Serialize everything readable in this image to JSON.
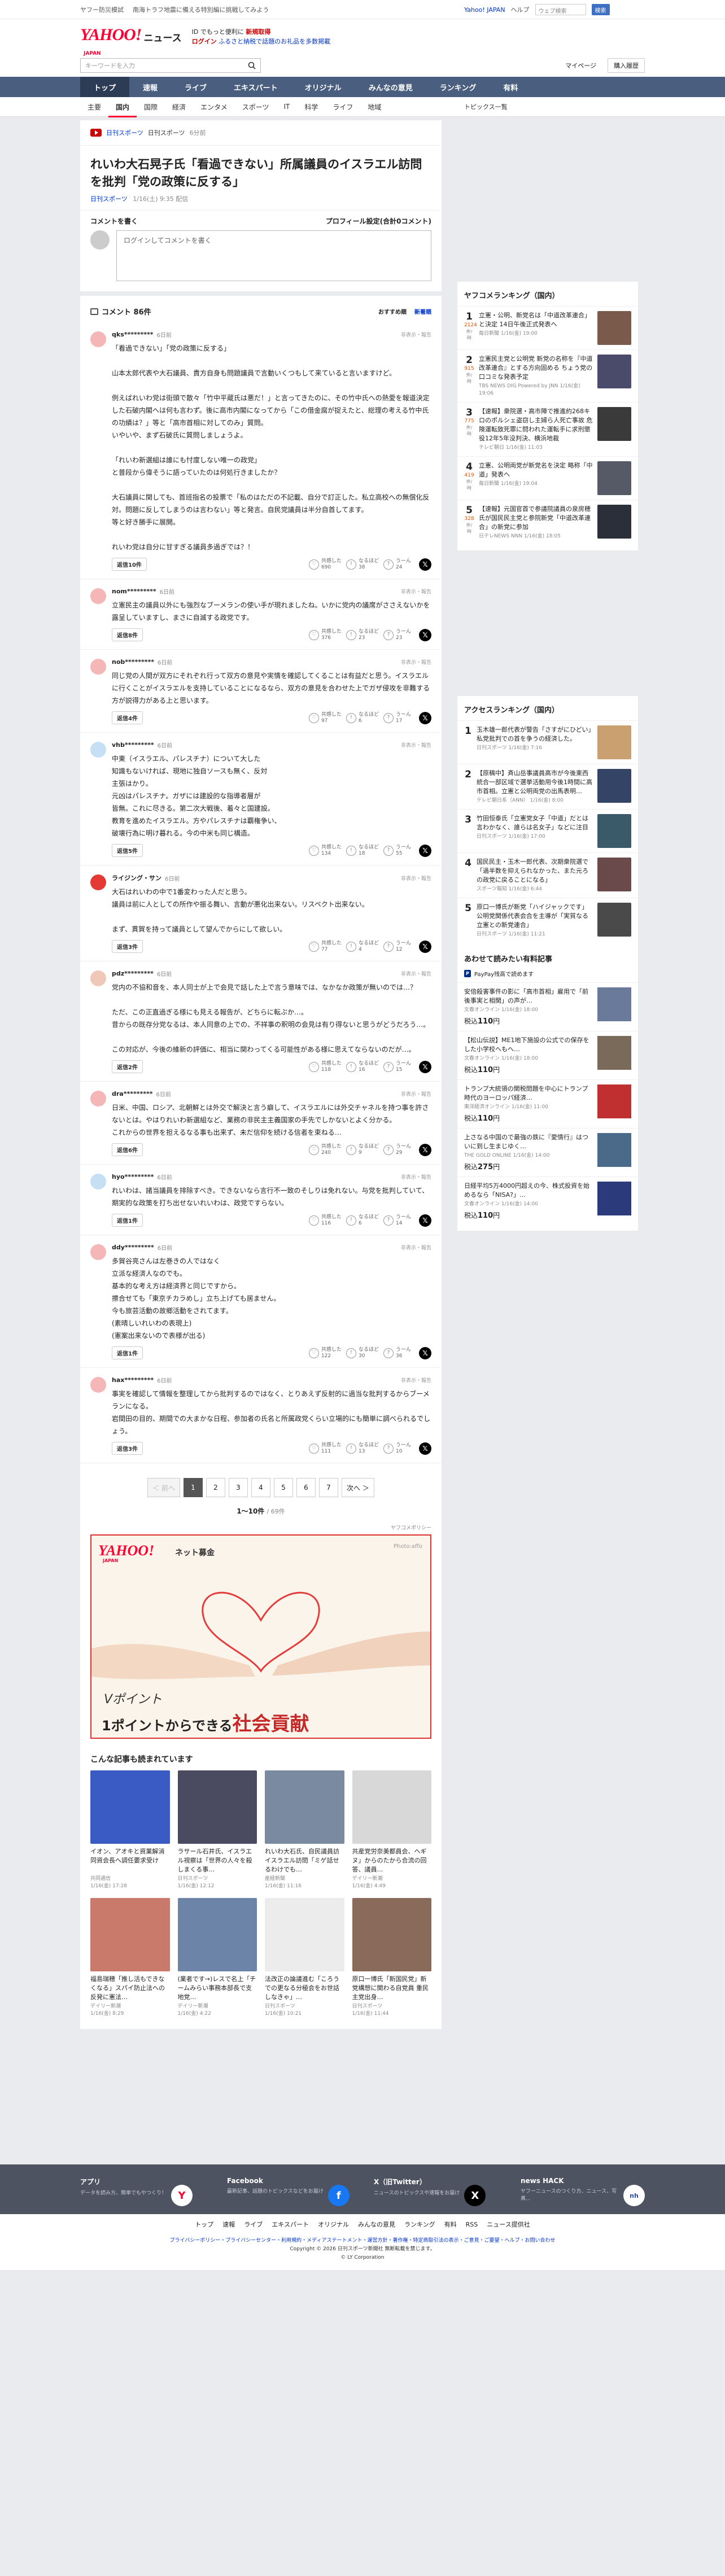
{
  "topbar": {
    "links": [
      "ヤフー防災模試",
      "南海トラフ地震に備える特別編に挑戦してみよう"
    ],
    "jp": "Yahoo! JAPAN",
    "help": "ヘルプ",
    "search_placeholder": "ウェブ検索",
    "search_btn": "検索"
  },
  "header": {
    "logo": "YAHOO!",
    "logo_sub": "JAPAN",
    "news": "ニュース",
    "promo_l1a": "ID でもっと便利に",
    "promo_l1b": "新規取得",
    "promo_l2a": "ログイン",
    "promo_l2b": "ふるさと納税で話題のお礼品を多数掲載"
  },
  "searchbar": {
    "placeholder": "キーワードを入力",
    "mypage": "マイページ",
    "purchase": "購入履歴"
  },
  "gnav": [
    "トップ",
    "速報",
    "ライブ",
    "エキスパート",
    "オリジナル",
    "みんなの意見",
    "ランキング",
    "有料"
  ],
  "subnav": [
    "主要",
    "国内",
    "国際",
    "経済",
    "エンタメ",
    "スポーツ",
    "IT",
    "科学",
    "ライフ",
    "地域"
  ],
  "subnav_right": "トピックス一覧",
  "article": {
    "source": "日刊スポーツ",
    "source_note": "日刊スポーツ",
    "source_time": "6分前",
    "title": "れいわ大石晃子氏「看過できない」所属議員のイスラエル訪問を批判「党の政策に反する」",
    "meta_src": "日刊スポーツ",
    "meta_time": "1/16(土) 9:35 配信"
  },
  "comment_form": {
    "heading": "コメントを書く",
    "profile_link": "プロフィール設定(合計0コメント)",
    "placeholder": "ログインしてコメントを書く"
  },
  "comments_head": {
    "title": "コメント 86件",
    "sort1": "おすすめ順",
    "sort2": "新着順"
  },
  "comment_labels": {
    "report": "非表示・報告",
    "reply": "返信",
    "like": "共感した",
    "think": "なるほど",
    "meh": "うーん"
  },
  "comments": [
    {
      "user": "qks*********",
      "time": "6日前",
      "text": "「看過できない」「党の政策に反する」\n\n山本太郎代表や大石議員、貴方自身も問題議員で言動いくつもして来ていると言いますけど。\n\n例えばれいわ党は街頭で散々「竹中平蔵氏は悪だ！」と言ってきたのに、その竹中氏への熱愛を報道決定した石破内閣へは何も言わず。後に高市内閣になってから「この借金腐が捉えたと、総理の考える竹中氏の功績は？」等と「高市首相に対してのみ」質問。\nいやいや、まず石破氏に質問しましょうよ。\n\n「れいわ新選組は誰にも忖度しない唯一の政党」\nと普段から偉そうに語っていたのは何処行きましたか？\n\n大石議員に関しても、首班指名の投票で「私のはただの不記載、自分で訂正した。私立高校への無償化反対。問題に反してしまうのは言わない」等と発言。自民党議員は半分自首してます。\n等と好き勝手に展開。\n\nれいわ党は自分に甘すぎる議員多過ぎでは？！",
      "like": "690",
      "think": "38",
      "meh": "24",
      "replies": "返信10件"
    },
    {
      "user": "nom*********",
      "time": "6日前",
      "text": "立憲民主の議員以外にも強烈なブーメランの使い手が現れましたね。いかに党内の議席がささえないかを露呈していますし、まさに自滅する政党です。",
      "like": "376",
      "think": "23",
      "meh": "23",
      "replies": "返信8件"
    },
    {
      "user": "nob*********",
      "time": "6日前",
      "text": "同じ党の人間が双方にそれぞれ行って双方の意見や実情を確認してくることは有益だと思う。イスラエルに行くことがイスラエルを支持していることになるなら、双方の意見を合わせた上でガザ侵攻を非難する方が説得力がある上と思います。",
      "like": "97",
      "think": "6",
      "meh": "17",
      "replies": "返信4件"
    },
    {
      "user": "vhb*********",
      "time": "6日前",
      "text": "中東（イスラエル、パレスチナ）について大した\n知識もないければ、現地に独自ソースも無く、反対\n主張はかり。\n元凶はパレスチナ。ガザには建設的な指導者層が\n皆無。これに尽きる。第二次大戦後、着々と国建設。\n教育を進めたイスラエル。方やパレスチナは覇権争い、\n破壊行為に明け暮れる。今の中米も同じ構造。",
      "like": "134",
      "think": "18",
      "meh": "55",
      "replies": "返信5件"
    },
    {
      "user": "ライジング・サン",
      "time": "6日前",
      "text": "大石はれいわの中で1番変わった人だと思う。\n議員は前に人としての所作や振る舞い、言動が悪化出来ない。リスペクト出来ない。\n\nまず、貫賀を持って議員として望んでからにして欲しい。",
      "like": "77",
      "think": "4",
      "meh": "12",
      "replies": "返信3件"
    },
    {
      "user": "pdz*********",
      "time": "6日前",
      "text": "党内の不協和音を、本人同士が上で会見で話した上で言う意味では、なかなか政策が無いのでは…？\n\nただ、この正直過ぎる様にも見える報告が、どちらに転ぶか…。\n昔からの既存分党なるは、本人同意の上での、不祥事の釈明の会見は有り得ないと思うがどうだろう…。\n\nこの対応が、今後の維新の評価に、相当に関わってくる可能性がある様に思えてならないのだが…。",
      "like": "118",
      "think": "16",
      "meh": "15",
      "replies": "返信2件"
    },
    {
      "user": "dra*********",
      "time": "6日前",
      "text": "日米、中国、ロシア、北朝鮮とは外交で解決と言う癖して、イスラエルには外交チャネルを持つ事を許さないとは。やはりれいわ新選組など、業務の非民主主義国家の手先でしかないとよく分かる。\nこれからの世界を担えるなる事も出来ず、未だ信仰を続ける信者を束ねる…",
      "like": "240",
      "think": "9",
      "meh": "29",
      "replies": "返信6件"
    },
    {
      "user": "hyo*********",
      "time": "6日前",
      "text": "れいわは、諸当議員を排除すべき。できないなら言行不一致のそしりは免れない。与党を批判していて、期実的な政策を打ち出せないれいわは、政党ですらない。",
      "like": "116",
      "think": "6",
      "meh": "14",
      "replies": "返信1件"
    },
    {
      "user": "ddy*********",
      "time": "6日前",
      "text": "多賀谷亮さんは左巻きの人ではなく\n立派な経済人なのでも。\n基本的な考え方は経済界と同じですから。\n擦合せても「東京チカラめし」立ち上げても居ません。\n今も旅芸活動の故郷活動をされてます。\n(素晴しいれいわの表現上)\n(憲案出来ないので表様が出る)",
      "like": "122",
      "think": "30",
      "meh": "36",
      "replies": "返信1件"
    },
    {
      "user": "hax*********",
      "time": "6日前",
      "text": "事実を確認して情報を整理してから批判するのではなく、とりあえず反射的に過当な批判するからブーメランになる。\n岩間田の目的、期間での大まかな日程、参加者の氏名と所属政党くらい立場的にも簡単に調べられるでしょう。",
      "like": "111",
      "think": "13",
      "meh": "10",
      "replies": "返信3件"
    }
  ],
  "pager": {
    "prev": "＜ 前へ",
    "pages": [
      "1",
      "2",
      "3",
      "4",
      "5",
      "6",
      "7"
    ],
    "next": "次へ ＞",
    "count": "1〜10件",
    "total": "/ 69件"
  },
  "ad": {
    "label": "ヤフコメポリシー",
    "logo": "YAHOO!",
    "logo_sub": "JAPAN",
    "kifu": "ネット募金",
    "photo": "Photo:affo",
    "l1": "Vポイント",
    "l1b": "1ポイントからできる",
    "l2": "社会貢献"
  },
  "related": {
    "heading": "こんな記事も読まれています",
    "cards": [
      {
        "title": "イオン、アオキと資業解消 同資会長へ調任要求受け",
        "src": "共同通信",
        "time": "1/16(金) 17:28",
        "color": "#3b5bc4"
      },
      {
        "title": "ラサール石井氏、イスラエル視察は「世界の人々を殺しまくる事…",
        "src": "日刊スポーツ",
        "time": "1/16(金) 12:12",
        "color": "#4a4a60"
      },
      {
        "title": "れいわ大石氏、自民議員訪イスラエル訪問「ミゲ話せるわけでも…",
        "src": "産経新聞",
        "time": "1/16(金) 11:16",
        "color": "#7a8aa0"
      },
      {
        "title": "共産党労奈美都員会、ヘギヌ」からのたから合流の回答、議員…",
        "src": "デイリー新潮",
        "time": "1/16(金) 4:49",
        "color": "#d8d8d8"
      },
      {
        "title": "福島瑞穂「推し活もできなくなる」スパイ防止法への反発に憲法…",
        "src": "デイリー新潮",
        "time": "1/16(金) 8:29",
        "color": "#c97a6a"
      },
      {
        "title": "(業者です→)レスで名上「チームみらい事務本部長で支地党…",
        "src": "デイリー新潮",
        "time": "1/16(金) 4:22",
        "color": "#6c84a8"
      },
      {
        "title": "法改正の論議進む「ころうでの更なる分極会をお世話しなきゃ」…",
        "src": "日刊スポーツ",
        "time": "1/16(金) 10:21",
        "color": "#ececec"
      },
      {
        "title": "原口一博氏「新国民党」新党構想に関わる自党員 重民主党出身…",
        "src": "日刊スポーツ",
        "time": "1/16(金) 11:44",
        "color": "#8a6a5a"
      }
    ]
  },
  "ranking": {
    "heading": "ヤフコメランキング（国内）",
    "items": [
      {
        "no": "1",
        "count": "2124",
        "unit": "件/時",
        "title": "立憲・公明、新党名は「中道改革連合」と決定 14日午後正式発表へ",
        "src": "毎日新聞 1/16(金) 19:00",
        "color": "#7a5a4a"
      },
      {
        "title": "立憲民主党と公明党 新党の名称を『中道改革連合』とする方向固める ちょう党の口コミな発表予定",
        "no": "2",
        "count": "915",
        "unit": "件/時",
        "src": "TBS NEWS DIG Powered by JNN 1/16(金) 19:06",
        "color": "#4a4a6a"
      },
      {
        "no": "3",
        "count": "775",
        "unit": "件/時",
        "title": "【速報】衆院選・高市陣で推進約268キロのポルシェ盗窃し主婦ら人死亡事故 危険運転致死罪に問われた運転手に求刑懲役12年5年没判決、横浜地裁",
        "src": "テレビ朝日 1/16(金) 11:03",
        "color": "#3a3a3a"
      },
      {
        "no": "4",
        "count": "419",
        "unit": "件/時",
        "title": "立憲、公明両党が新党名を決定 略称「中道」発表へ",
        "src": "毎日新聞 1/16(金) 19:04",
        "color": "#555a66"
      },
      {
        "no": "5",
        "count": "328",
        "unit": "件/時",
        "title": "【速報】元国官首で参議院議員の泉房穂氏が国民民主党と参院新党「中道改革連合」の新党に参加",
        "src": "日テレNEWS NNN 1/16(金) 18:05",
        "color": "#2a2f3a"
      }
    ]
  },
  "access": {
    "heading": "アクセスランキング（国内）",
    "items": [
      {
        "no": "1",
        "title": "玉木雄一郎代表が警告「さすがにひどい」私党批判での首を争うの経済した。",
        "src": "日刊スポーツ 1/16(金) 7:16",
        "color": "#c9a070"
      },
      {
        "no": "2",
        "title": "【原稿中】斉山岳事議員高市が今後東西統合一部区域で選挙活動用今後1時間に高市首相。立憲と公明両党の出馬表明…",
        "src": "テレビ朝日系（ANN） 1/16(金) 8:00",
        "color": "#334466"
      },
      {
        "no": "3",
        "title": "竹田恒泰氏「立憲党女子「中道」だとは言わかなく、誰らは名女子」などに注目",
        "src": "日刊スポーツ 1/16(金) 17:00",
        "color": "#3a5a6a"
      },
      {
        "no": "4",
        "title": "国民民主・玉木一郎代表、次期衆院選で「過半数を抑えられなかった、また元ろの政党に戻ることになる」",
        "src": "スポーツ報知 1/16(金) 6:44",
        "color": "#6a4a4a"
      },
      {
        "no": "5",
        "title": "原口一博氏が新党「ハイジャックです」公明党関係代表会合を主導が「実質なる立憲との新党連合」",
        "src": "日刊スポーツ 1/16(金) 11:21",
        "color": "#4a4a4a"
      }
    ]
  },
  "affiliate": {
    "heading": "あわせて読みたい有料記事",
    "pp_label": "PayPay残高で読めます",
    "items": [
      {
        "title": "安倍殺害事件の影に「高市首相」雇用で「前後事実と相関」の声が…",
        "src": "文春オンライン 1/16(金) 18:00",
        "price": "110",
        "color": "#6a7a9a"
      },
      {
        "title": "【松山伝説】ME1地下施設の公式での保存をした小学校へもへ…",
        "src": "文春オンライン 1/16(金) 18:00",
        "price": "110",
        "color": "#7a6a5a"
      },
      {
        "title": "トランプ大統領の関税問題を中心にトランプ時代のヨーロッパ経済…",
        "src": "東洋経済オンライン 1/16(金) 11:00",
        "price": "110",
        "color": "#c03030"
      },
      {
        "title": "上さなる中国ので最強の鉄に『愛情行』はついに到し生まじゆく…",
        "src": "THE GOLD ONLINE 1/16(金) 14:00",
        "price": "275",
        "color": "#4a6a8a"
      },
      {
        "title": "日経平均5万4000円超えの今、株式投資を始めるなら「NISA?」…",
        "src": "文春オンライン 1/16(金) 14:00",
        "price": "110",
        "color": "#2a3a7a"
      }
    ]
  },
  "footer": {
    "cols": [
      {
        "t": "アプリ",
        "c": "データを読み方、簡単でもやつくり！",
        "ic": "Y"
      },
      {
        "t": "Facebook",
        "c": "最新記事、話題のトピックスなどをお届け",
        "ic": "f"
      },
      {
        "t": "X（旧Twitter）",
        "c": "ニュースのトピックスや速報をお届け",
        "ic": "X"
      },
      {
        "t": "news HACK",
        "c": "ヤフーニュースのつくり方、ニュース、写真…",
        "ic": "nh"
      }
    ],
    "nav": [
      "トップ",
      "速報",
      "ライブ",
      "エキスパート",
      "オリジナル",
      "みんなの意見",
      "ランキング",
      "有料",
      "RSS",
      "ニュース提供社"
    ],
    "links": "プライバシーポリシー・プライバシーセンター・利用規約・メディアステートメント・運営方針・著作権・特定商取引法の表示・ご意見・ご要望・ヘルプ・お問い合わせ",
    "copy1": "Copyright © 2026 日刊スポーツ新聞社 無断転載を禁じます。",
    "copy2": "© LY Corporation"
  }
}
